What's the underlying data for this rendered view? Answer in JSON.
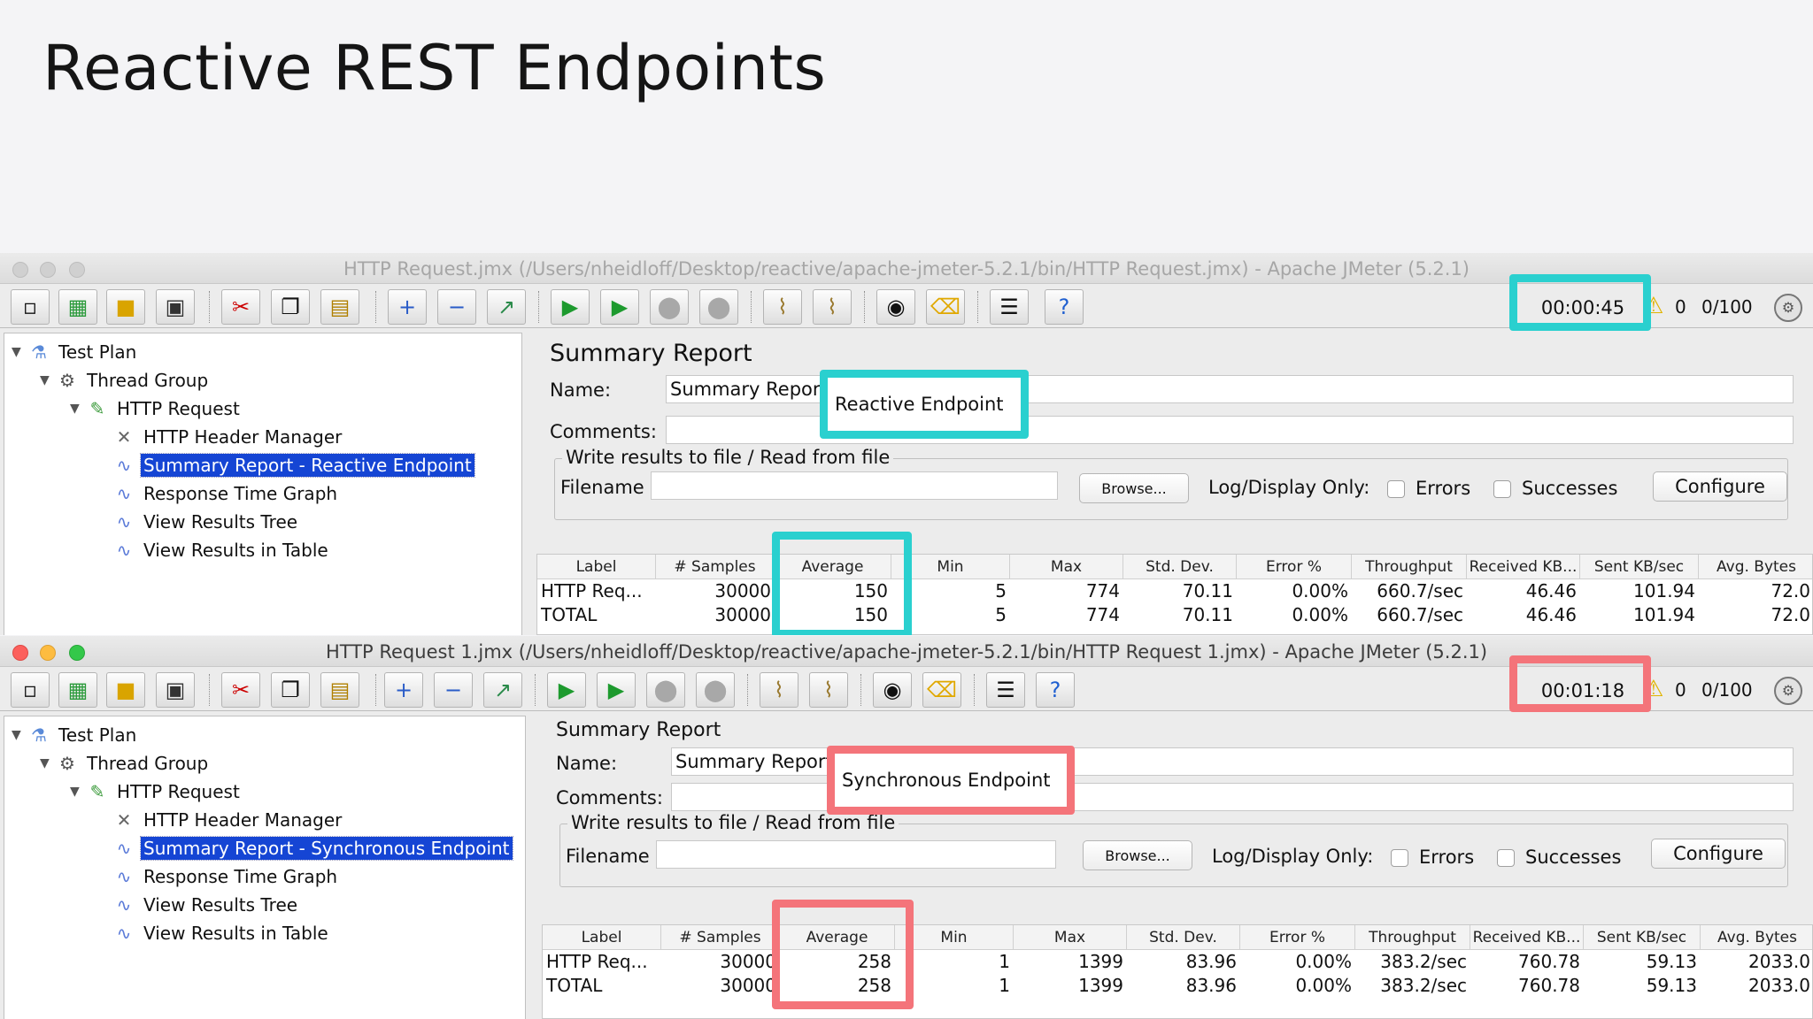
{
  "slide": {
    "title": "Reactive REST Endpoints"
  },
  "colors": {
    "highlight_teal": "#2ad0cf",
    "highlight_pink": "#f4747a",
    "selection_blue": "#1545d4"
  },
  "windows": [
    {
      "title": "HTTP Request.jmx (/Users/nheidloff/Desktop/reactive/apache-jmeter-5.2.1/bin/HTTP Request.jmx) - Apache JMeter (5.2.1)",
      "active": false,
      "timer": "00:00:45",
      "warning_count": "0",
      "thread_count": "0/100",
      "tree": [
        {
          "label": "Test Plan",
          "icon": "flask-icon"
        },
        {
          "label": "Thread Group",
          "icon": "gear-icon"
        },
        {
          "label": "HTTP Request",
          "icon": "pipette-icon"
        },
        {
          "label": "HTTP Header Manager",
          "icon": "wrench-icon"
        },
        {
          "label": "Summary Report - Reactive Endpoint",
          "icon": "graph-icon",
          "selected": true
        },
        {
          "label": "Response Time Graph",
          "icon": "graph-icon"
        },
        {
          "label": "View Results Tree",
          "icon": "graph-icon"
        },
        {
          "label": "View Results in Table",
          "icon": "graph-icon"
        }
      ],
      "panel": {
        "title": "Summary Report",
        "name_label": "Name:",
        "name_value": "Summary Report",
        "name_highlight": "Reactive Endpoint",
        "comments_label": "Comments:",
        "comments_value": "",
        "fieldset_legend": "Write results to file / Read from file",
        "filename_label": "Filename",
        "filename_value": "",
        "browse_label": "Browse...",
        "log_display_label": "Log/Display Only:",
        "errors_label": "Errors",
        "successes_label": "Successes",
        "configure_label": "Configure"
      },
      "table": {
        "headers": [
          "Label",
          "# Samples",
          "Average",
          "Min",
          "Max",
          "Std. Dev.",
          "Error %",
          "Throughput",
          "Received KB...",
          "Sent KB/sec",
          "Avg. Bytes"
        ],
        "rows": [
          [
            "HTTP Req...",
            "30000",
            "150",
            "5",
            "774",
            "70.11",
            "0.00%",
            "660.7/sec",
            "46.46",
            "101.94",
            "72.0"
          ],
          [
            "TOTAL",
            "30000",
            "150",
            "5",
            "774",
            "70.11",
            "0.00%",
            "660.7/sec",
            "46.46",
            "101.94",
            "72.0"
          ]
        ]
      }
    },
    {
      "title": "HTTP Request 1.jmx (/Users/nheidloff/Desktop/reactive/apache-jmeter-5.2.1/bin/HTTP Request 1.jmx) - Apache JMeter (5.2.1)",
      "active": true,
      "timer": "00:01:18",
      "warning_count": "0",
      "thread_count": "0/100",
      "tree": [
        {
          "label": "Test Plan",
          "icon": "flask-icon"
        },
        {
          "label": "Thread Group",
          "icon": "gear-icon"
        },
        {
          "label": "HTTP Request",
          "icon": "pipette-icon"
        },
        {
          "label": "HTTP Header Manager",
          "icon": "wrench-icon"
        },
        {
          "label": "Summary Report - Synchronous Endpoint",
          "icon": "graph-icon",
          "selected": true
        },
        {
          "label": "Response Time Graph",
          "icon": "graph-icon"
        },
        {
          "label": "View Results Tree",
          "icon": "graph-icon"
        },
        {
          "label": "View Results in Table",
          "icon": "graph-icon"
        }
      ],
      "panel": {
        "title": "Summary Report",
        "name_label": "Name:",
        "name_value": "Summary Report",
        "name_highlight": "Synchronous Endpoint",
        "comments_label": "Comments:",
        "comments_value": "",
        "fieldset_legend": "Write results to file / Read from file",
        "filename_label": "Filename",
        "filename_value": "",
        "browse_label": "Browse...",
        "log_display_label": "Log/Display Only:",
        "errors_label": "Errors",
        "successes_label": "Successes",
        "configure_label": "Configure"
      },
      "table": {
        "headers": [
          "Label",
          "# Samples",
          "Average",
          "Min",
          "Max",
          "Std. Dev.",
          "Error %",
          "Throughput",
          "Received KB...",
          "Sent KB/sec",
          "Avg. Bytes"
        ],
        "rows": [
          [
            "HTTP Req...",
            "30000",
            "258",
            "1",
            "1399",
            "83.96",
            "0.00%",
            "383.2/sec",
            "760.78",
            "59.13",
            "2033.0"
          ],
          [
            "TOTAL",
            "30000",
            "258",
            "1",
            "1399",
            "83.96",
            "0.00%",
            "383.2/sec",
            "760.78",
            "59.13",
            "2033.0"
          ]
        ]
      }
    }
  ],
  "toolbar_icons": [
    "new-icon",
    "templates-icon",
    "open-icon",
    "save-icon",
    "cut-icon",
    "copy-icon",
    "paste-icon",
    "expand-icon",
    "collapse-icon",
    "toggle-icon",
    "start-icon",
    "start-no-pause-icon",
    "stop-icon",
    "shutdown-icon",
    "clear-icon",
    "clear-all-icon",
    "search-icon",
    "reset-search-icon",
    "function-helper-icon",
    "help-icon"
  ]
}
